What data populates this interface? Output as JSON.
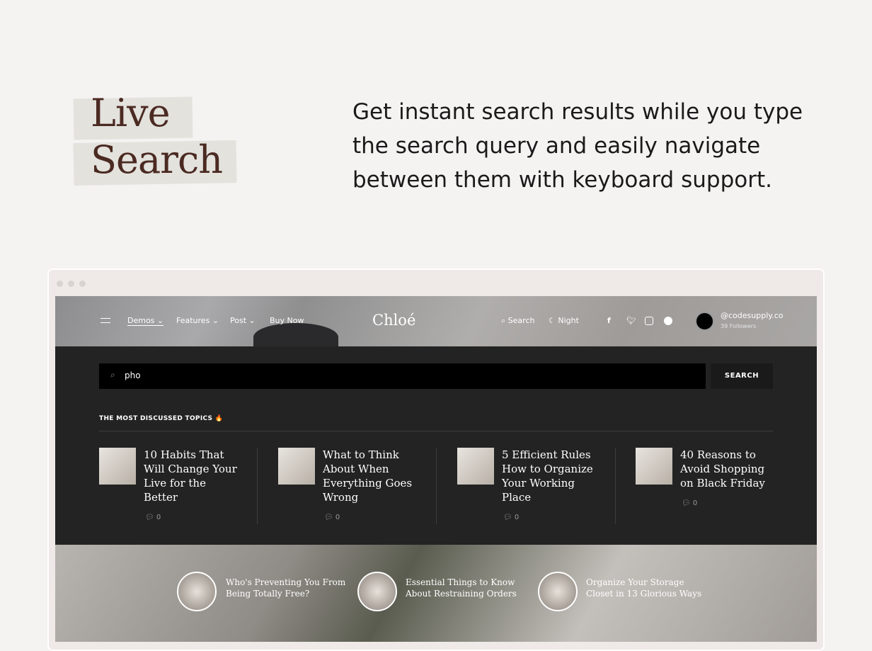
{
  "hero": {
    "title_line1": "Live",
    "title_line2": "Search",
    "description": "Get instant search results while you type the search query and easily navigate between them with keyboard support."
  },
  "site": {
    "nav": [
      {
        "label": "Demos"
      },
      {
        "label": "Features"
      },
      {
        "label": "Post"
      },
      {
        "label": "Buy Now"
      }
    ],
    "logo": "Chloé",
    "search_label": "Search",
    "night_label": "Night",
    "social": [
      "facebook-icon",
      "twitter-icon",
      "instagram-icon",
      "pinterest-icon"
    ],
    "account": {
      "handle": "@codesupply.co",
      "followers": "39 Followers"
    },
    "search": {
      "value": "pho",
      "button": "SEARCH"
    },
    "topics_heading": "THE MOST DISCUSSED TOPICS 🔥",
    "articles": [
      {
        "title": "10 Habits That Will Change Your Live for the Better",
        "comments": "0"
      },
      {
        "title": "What to Think About When Everything Goes Wrong",
        "comments": "0"
      },
      {
        "title": "5 Efficient Rules How to Organize Your Working Place",
        "comments": "0"
      },
      {
        "title": "40 Reasons to Avoid Shopping on Black Friday",
        "comments": "0"
      }
    ],
    "featured": [
      {
        "title": "Who's Preventing You From Being Totally Free?"
      },
      {
        "title": "Essential Things to Know About Restraining Orders"
      },
      {
        "title": "Organize Your Storage Closet in 13 Glorious Ways"
      }
    ]
  }
}
